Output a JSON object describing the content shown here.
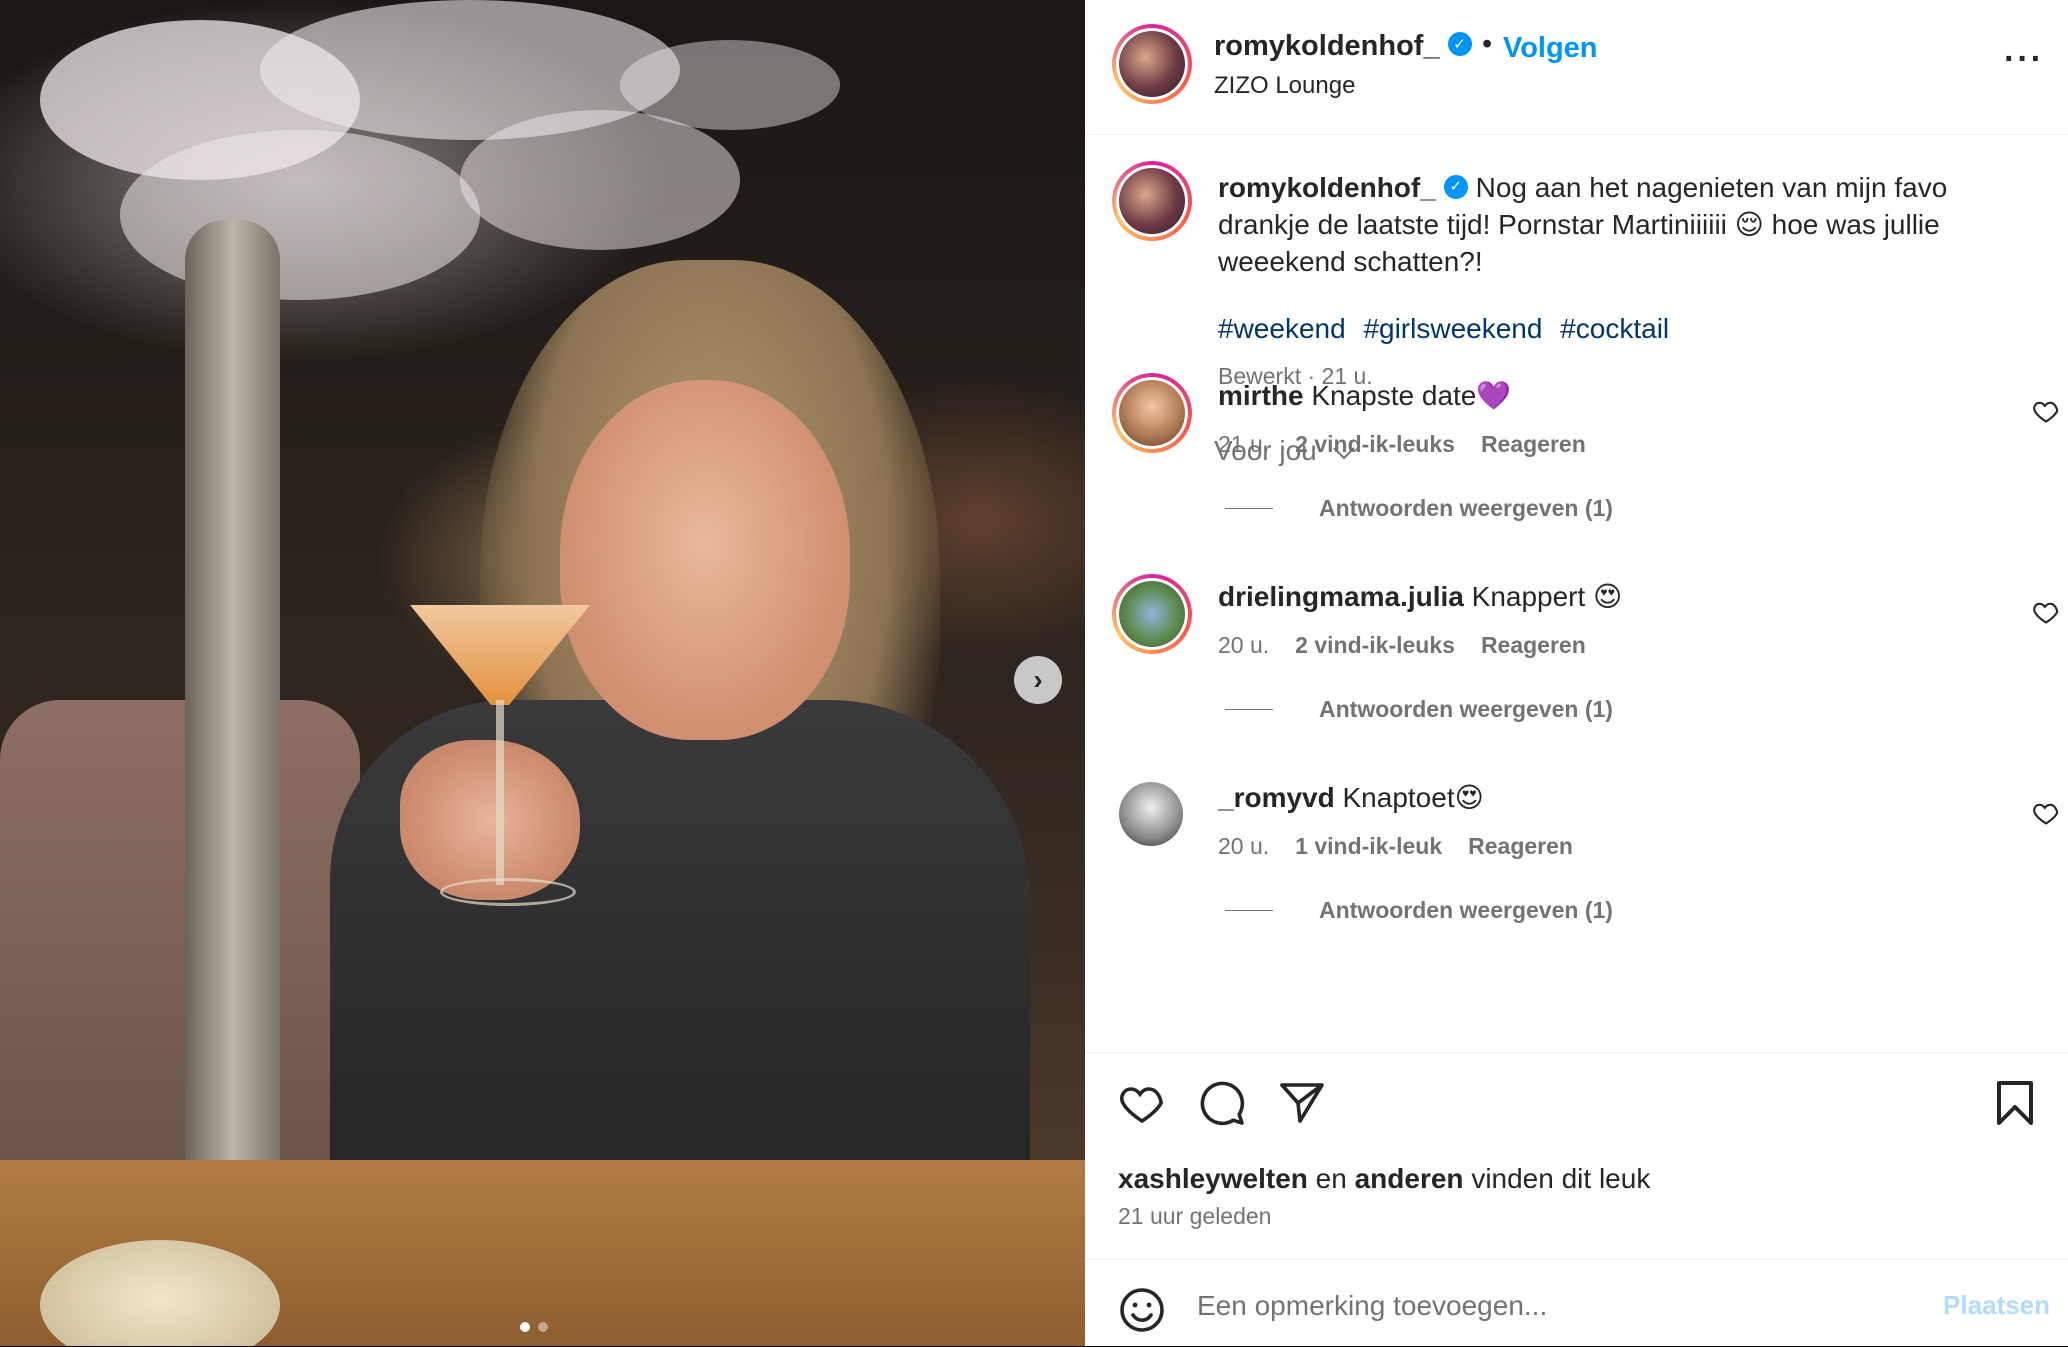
{
  "post": {
    "username": "romykoldenhof_",
    "separator": "•",
    "follow_label": "Volgen",
    "location": "ZIZO Lounge",
    "more_icon": "more-icon",
    "more_glyph": "···"
  },
  "caption": {
    "username": "romykoldenhof_",
    "text": "Nog aan het nagenieten van mijn favo drankje de laatste tijd! Pornstar Martiniiiiii 😌 hoe was jullie weeekend schatten?!",
    "hashtags": [
      "#weekend",
      "#girlsweekend",
      "#cocktail"
    ],
    "meta": "Bewerkt · 21 u."
  },
  "sort": {
    "label": "Voor jou",
    "icon": "chevron-down-icon"
  },
  "comments": [
    {
      "user": "mirthe",
      "text": "Knapste date💜",
      "time": "21 u.",
      "likes": "2 vind-ik-leuks",
      "reply": "Reageren",
      "replies": "Antwoorden weergeven (1)"
    },
    {
      "user": "drielingmama.julia",
      "text": "Knappert 😍",
      "time": "20 u.",
      "likes": "2 vind-ik-leuks",
      "reply": "Reageren",
      "replies": "Antwoorden weergeven (1)"
    },
    {
      "user": "_romyvd",
      "text": "Knaptoet😍",
      "time": "20 u.",
      "likes": "1 vind-ik-leuk",
      "reply": "Reageren",
      "replies": "Antwoorden weergeven (1)"
    }
  ],
  "likes": {
    "user": "xashleywelten",
    "joiner": "en",
    "others": "anderen",
    "suffix": "vinden dit leuk"
  },
  "posted": "21 uur geleden",
  "add_comment": {
    "placeholder": "Een opmerking toevoegen...",
    "post_label": "Plaatsen"
  },
  "carousel": {
    "next_glyph": "›",
    "count": 2,
    "active": 1
  },
  "colors": {
    "accent": "#0095f6",
    "hashtag": "#00376b",
    "muted": "#737373",
    "post_disabled": "#b3dbff"
  }
}
